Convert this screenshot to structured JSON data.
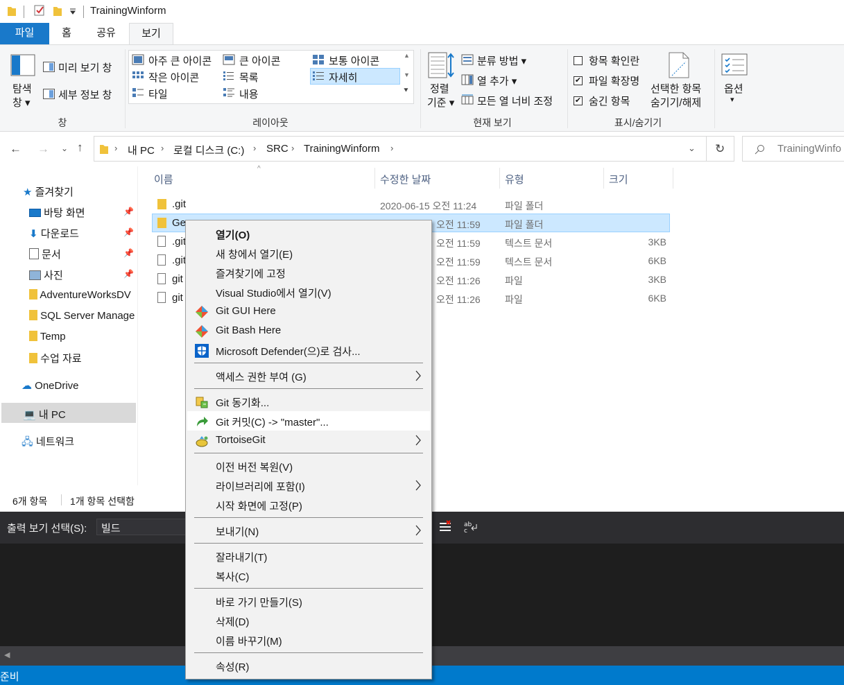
{
  "title_bar": {
    "title": "TrainingWinform"
  },
  "ribbon_tabs": [
    "파일",
    "홈",
    "공유",
    "보기"
  ],
  "ribbon": {
    "pane_group": {
      "navigation_pane": "탐색",
      "navigation_pane_sub": "창",
      "preview_pane": "미리 보기 창",
      "details_pane": "세부 정보 창",
      "label": "창"
    },
    "layout_group": {
      "items": [
        "아주 큰 아이콘",
        "큰 아이콘",
        "보통 아이콘",
        "작은 아이콘",
        "목록",
        "자세히",
        "타일",
        "내용"
      ],
      "selected": "자세히",
      "label": "레이아웃"
    },
    "current_view_group": {
      "sort_by_line1": "정렬",
      "sort_by_line2": "기준",
      "group_by": "분류 방법",
      "add_columns": "열 추가",
      "size_all_columns": "모든 열 너비 조정",
      "label": "현재 보기"
    },
    "show_hide_group": {
      "item_check_boxes": "항목 확인란",
      "item_check_boxes_checked": false,
      "file_name_extensions": "파일 확장명",
      "file_name_extensions_checked": true,
      "hidden_items": "숨긴 항목",
      "hidden_items_checked": true,
      "hide_selected_line1": "선택한 항목",
      "hide_selected_line2": "숨기기/해제",
      "label": "표시/숨기기"
    },
    "options": "옵션"
  },
  "address_bar": {
    "breadcrumbs": [
      "내 PC",
      "로컬 디스크 (C:)",
      "SRC",
      "TrainingWinform"
    ],
    "search_placeholder": "TrainingWinfo"
  },
  "nav_pane": {
    "quick_access": "즐겨찾기",
    "pinned": [
      "바탕 화면",
      "다운로드",
      "문서",
      "사진"
    ],
    "folders": [
      "AdventureWorksDV",
      "SQL Server Manage",
      "Temp",
      "수업 자료"
    ],
    "onedrive": "OneDrive",
    "this_pc": "내 PC",
    "network": "네트워크"
  },
  "file_list": {
    "columns": [
      "이름",
      "수정한 날짜",
      "유형",
      "크기"
    ],
    "rows": [
      {
        "name": ".git",
        "date": "2020-06-15 오전 11:24",
        "type": "파일 폴더",
        "size": ""
      },
      {
        "name": "Ge",
        "date": "오전 11:59",
        "type": "파일 폴더",
        "size": ""
      },
      {
        "name": ".git",
        "date": "오전 11:59",
        "type": "텍스트 문서",
        "size": "3KB"
      },
      {
        "name": ".git",
        "date": "오전 11:59",
        "type": "텍스트 문서",
        "size": "6KB"
      },
      {
        "name": "git",
        "date": "오전 11:26",
        "type": "파일",
        "size": "3KB"
      },
      {
        "name": "git",
        "date": "오전 11:26",
        "type": "파일",
        "size": "6KB"
      }
    ]
  },
  "status_bar": {
    "item_count": "6개 항목",
    "selected_count": "1개 항목 선택함"
  },
  "output_pane": {
    "label": "출력 보기 선택(S):",
    "value": "빌드",
    "status": "준비"
  },
  "context_menu": {
    "items": [
      "열기(O)",
      "새 창에서 열기(E)",
      "즐겨찾기에 고정",
      "Visual Studio에서 열기(V)",
      "Git GUI Here",
      "Git Bash Here",
      "Microsoft Defender(으)로 검사...",
      "액세스 권한 부여 (G)",
      "Git 동기화...",
      "Git 커밋(C) -> \"master\"...",
      "TortoiseGit",
      "이전 버전 복원(V)",
      "라이브러리에 포함(I)",
      "시작 화면에 고정(P)",
      "보내기(N)",
      "잘라내기(T)",
      "복사(C)",
      "바로 가기 만들기(S)",
      "삭제(D)",
      "이름 바꾸기(M)",
      "속성(R)"
    ],
    "highlighted": "Git 커밋(C) -> \"master\"..."
  }
}
